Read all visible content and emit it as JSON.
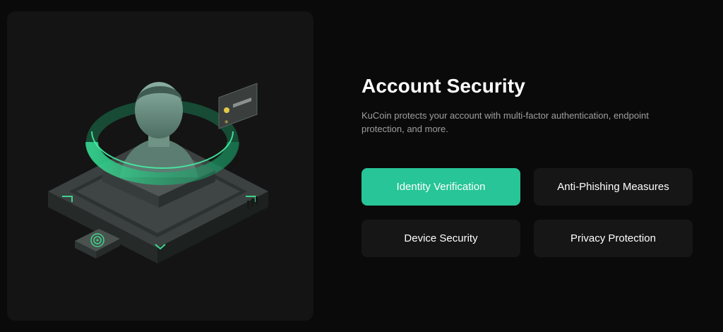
{
  "section": {
    "title": "Account Security",
    "description": "KuCoin protects your account with multi-factor authentication, endpoint protection, and more."
  },
  "options": [
    {
      "label": "Identity Verification",
      "active": true
    },
    {
      "label": "Anti-Phishing Measures",
      "active": false
    },
    {
      "label": "Device Security",
      "active": false
    },
    {
      "label": "Privacy Protection",
      "active": false
    }
  ],
  "colors": {
    "accent": "#27c597",
    "page_background": "#0a0a0a",
    "card_background": "#141414",
    "option_background": "#161616",
    "description_text": "#9e9e9e"
  },
  "illustration": {
    "icons": [
      "user-avatar-icon",
      "fingerprint-icon",
      "id-card-icon",
      "security-ring-icon"
    ]
  }
}
